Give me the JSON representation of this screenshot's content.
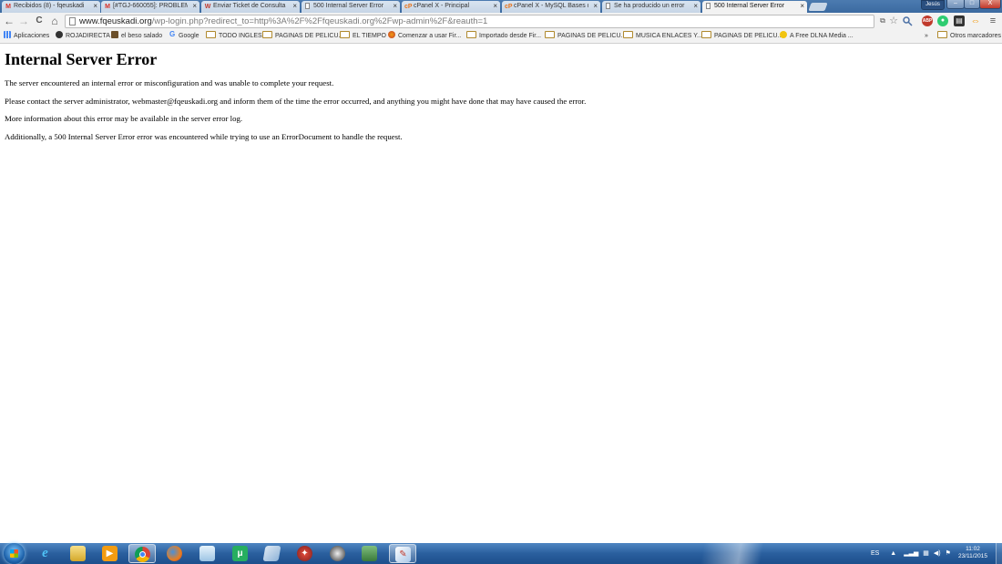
{
  "browser": {
    "tabs": [
      {
        "label": "Recibidos (8) - fqeuskadi",
        "favicon": "M",
        "favicon_color": "#d93025",
        "active": false
      },
      {
        "label": "[#TGJ-660055]: PROBLEM",
        "favicon": "M",
        "favicon_color": "#d93025",
        "active": false
      },
      {
        "label": "Enviar Ticket de Consulta",
        "favicon": "W",
        "favicon_color": "#c0392b",
        "active": false
      },
      {
        "label": "500 Internal Server Error",
        "favicon": "",
        "favicon_color": "#888888",
        "active": false
      },
      {
        "label": "cPanel X - Principal",
        "favicon": "cP",
        "favicon_color": "#e8731a",
        "active": false
      },
      {
        "label": "cPanel X - MySQL Bases d",
        "favicon": "cP",
        "favicon_color": "#e8731a",
        "active": false
      },
      {
        "label": "Se ha producido un error",
        "favicon": "",
        "favicon_color": "#888888",
        "active": false
      },
      {
        "label": "500 Internal Server Error",
        "favicon": "",
        "favicon_color": "#888888",
        "active": true
      }
    ],
    "tab_close_glyph": "×",
    "user_badge": "Jesús",
    "window_buttons": {
      "minimize": "–",
      "maximize": "□",
      "close": "X"
    },
    "url_host": "www.fqeuskadi.org",
    "url_path": "/wp-login.php?redirect_to=http%3A%2F%2Ffqeuskadi.org%2Fwp-admin%2F&reauth=1",
    "nav": {
      "back": "←",
      "forward": "→",
      "reload": "C",
      "home": "⌂"
    },
    "bookmarks": [
      {
        "label": "Aplicaciones",
        "type": "apps"
      },
      {
        "label": "ROJADIRECTA",
        "type": "site"
      },
      {
        "label": "el beso salado",
        "type": "site"
      },
      {
        "label": "Google",
        "type": "google"
      },
      {
        "label": "TODO INGLES",
        "type": "folder"
      },
      {
        "label": "PAGINAS DE PELICU...",
        "type": "folder"
      },
      {
        "label": "EL TIEMPO",
        "type": "folder"
      },
      {
        "label": "Comenzar a usar Fir...",
        "type": "firefox"
      },
      {
        "label": "Importado desde Fir...",
        "type": "folder"
      },
      {
        "label": "PAGINAS DE PELICU...",
        "type": "folder"
      },
      {
        "label": "MUSICA ENLACES Y...",
        "type": "folder"
      },
      {
        "label": "PAGINAS DE PELICU...",
        "type": "folder"
      },
      {
        "label": "A Free DLNA Media ...",
        "type": "site"
      }
    ],
    "bookmarks_overflow": "»",
    "other_bookmarks": "Otros marcadores"
  },
  "page": {
    "title": "Internal Server Error",
    "paragraphs": [
      "The server encountered an internal error or misconfiguration and was unable to complete your request.",
      "Please contact the server administrator, webmaster@fqeuskadi.org and inform them of the time the error occurred, and anything you might have done that may have caused the error.",
      "More information about this error may be available in the server error log.",
      "Additionally, a 500 Internal Server Error error was encountered while trying to use an ErrorDocument to handle the request."
    ]
  },
  "taskbar": {
    "language": "ES",
    "time": "11:02",
    "date": "23/11/2015"
  }
}
